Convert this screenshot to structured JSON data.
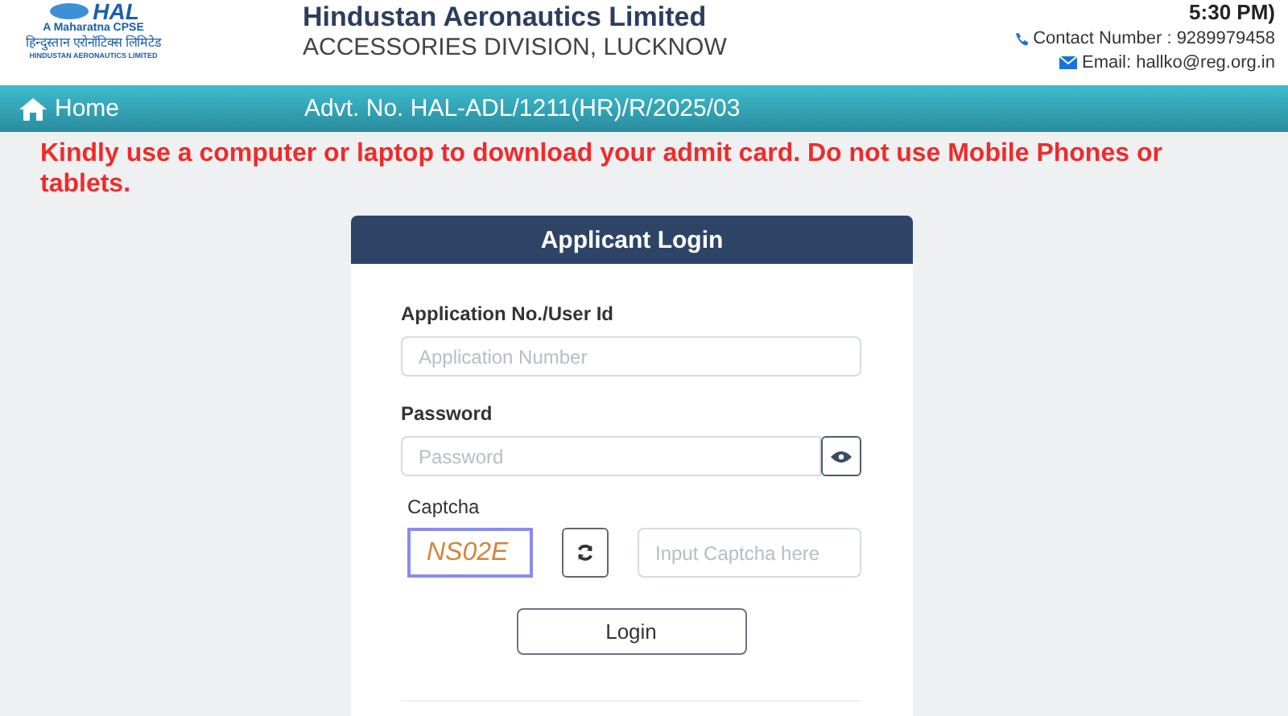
{
  "logo": {
    "mark": "HAL",
    "tagline": "A Maharatna CPSE",
    "hindi_name": "हिन्दुस्तान एरोनॉटिक्स लिमिटेड",
    "english_name": "HINDUSTAN AERONAUTICS LIMITED"
  },
  "header": {
    "title": "Hindustan Aeronautics Limited",
    "subtitle": "ACCESSORIES DIVISION, LUCKNOW",
    "time_note": "5:30 PM)",
    "contact": "Contact Number : 9289979458",
    "email": "Email: hallko@reg.org.in"
  },
  "nav": {
    "home": "Home",
    "advt": "Advt. No. HAL-ADL/1211(HR)/R/2025/03"
  },
  "warning": "Kindly use a computer or laptop to download your admit card. Do not use Mobile Phones or tablets.",
  "login": {
    "title": "Applicant Login",
    "user_label": "Application No./User Id",
    "user_placeholder": "Application Number",
    "password_label": "Password",
    "password_placeholder": "Password",
    "captcha_label": "Captcha",
    "captcha_code": "NS02E",
    "captcha_placeholder": "Input Captcha here",
    "button": "Login"
  }
}
